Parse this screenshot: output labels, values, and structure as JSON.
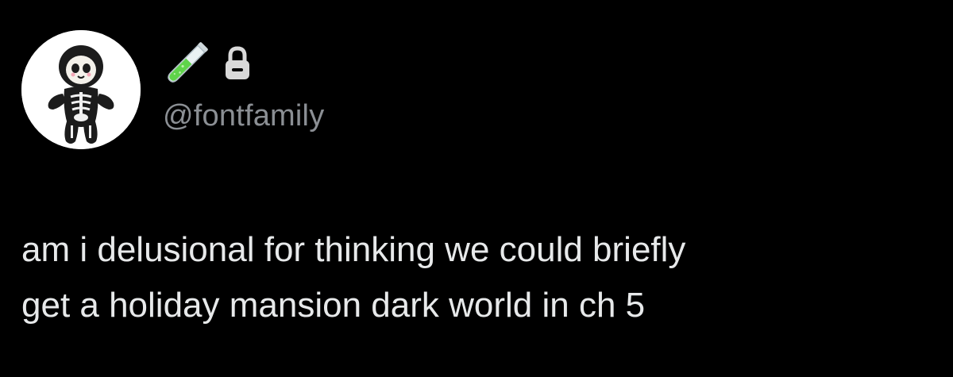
{
  "author": {
    "handle": "@fontfamily",
    "name_emoji_icon": "test-tube-icon",
    "protected_icon": "lock-icon",
    "avatar_icon": "skeleton-plush-avatar"
  },
  "tweet": {
    "lines": [
      "am i delusional for thinking we could briefly",
      "get a holiday mansion dark world in ch 5"
    ]
  },
  "colors": {
    "background": "#000000",
    "text": "#e7e9ea",
    "handle": "#8b8f94",
    "test_tube_liquid": "#5fd34a",
    "lock": "#d9d9d9"
  }
}
